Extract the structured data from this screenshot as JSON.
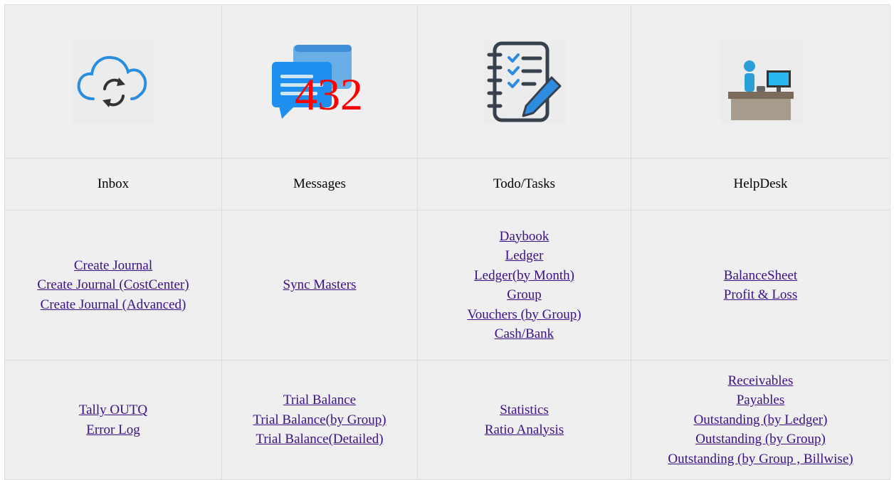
{
  "tiles": [
    {
      "label": "Inbox",
      "icon": "cloud-sync-icon"
    },
    {
      "label": "Messages",
      "icon": "chat-bubbles-icon",
      "badge": "432"
    },
    {
      "label": "Todo/Tasks",
      "icon": "checklist-notebook-icon"
    },
    {
      "label": "HelpDesk",
      "icon": "helpdesk-desk-icon"
    }
  ],
  "links_row1": [
    [
      "Create Journal ",
      "Create Journal (CostCenter)",
      "Create Journal (Advanced)"
    ],
    [
      "Sync Masters"
    ],
    [
      "Daybook",
      "Ledger",
      "Ledger(by Month)",
      "Group",
      "Vouchers (by Group)",
      "Cash/Bank"
    ],
    [
      "BalanceSheet",
      "Profit & Loss"
    ]
  ],
  "links_row2": [
    [
      "Tally OUTQ",
      "Error Log"
    ],
    [
      "Trial Balance",
      "Trial Balance(by Group)",
      "Trial Balance(Detailed)"
    ],
    [
      "Statistics",
      "Ratio Analysis"
    ],
    [
      "Receivables",
      "Payables",
      "Outstanding (by Ledger)",
      "Outstanding (by Group)",
      "Outstanding (by Group , Billwise)"
    ]
  ],
  "colors": {
    "cell_bg": "#efefef",
    "link": "#3a0f86",
    "badge": "#ff0000",
    "cloud": "#2a8ee0",
    "bubble": "#2196f3"
  }
}
